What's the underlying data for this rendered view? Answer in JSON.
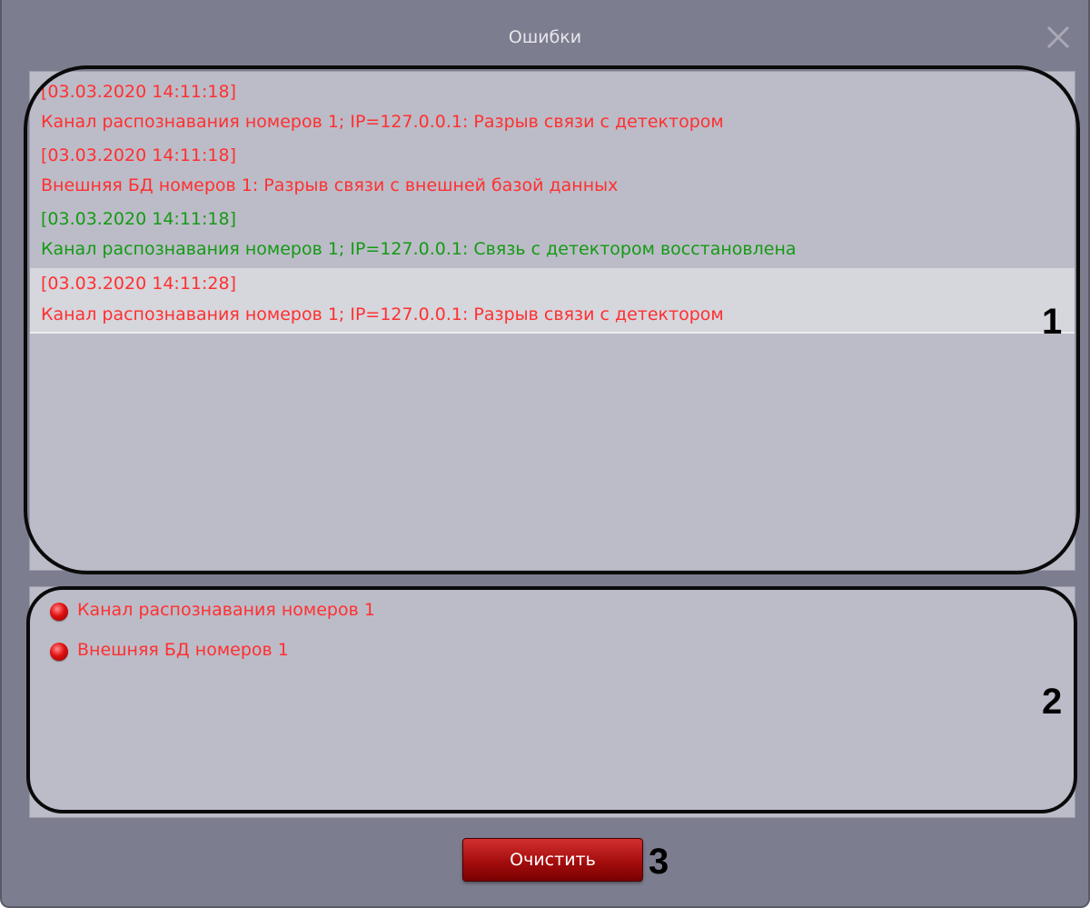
{
  "window": {
    "title": "Ошибки",
    "close_icon": "close-icon"
  },
  "log": {
    "entries": [
      {
        "timestamp": "[03.03.2020 14:11:18]",
        "message": "Канал распознавания номеров 1; IP=127.0.0.1: Разрыв связи с детектором",
        "status": "error",
        "selected": false
      },
      {
        "timestamp": "[03.03.2020 14:11:18]",
        "message": "Внешняя БД номеров 1: Разрыв связи с внешней базой данных",
        "status": "error",
        "selected": false
      },
      {
        "timestamp": "[03.03.2020 14:11:18]",
        "message": "Канал распознавания номеров 1; IP=127.0.0.1: Связь с детектором восстановлена",
        "status": "ok",
        "selected": false
      },
      {
        "timestamp": "[03.03.2020 14:11:28]",
        "message": "Канал распознавания номеров 1; IP=127.0.0.1: Разрыв связи с детектором",
        "status": "error",
        "selected": true
      }
    ]
  },
  "status_list": {
    "items": [
      {
        "label": "Канал распознавания номеров 1",
        "icon": "red-status-dot-icon"
      },
      {
        "label": "Внешняя БД номеров 1",
        "icon": "red-status-dot-icon"
      }
    ]
  },
  "actions": {
    "clear_label": "Очистить"
  },
  "annotations": {
    "marker_1": "1",
    "marker_2": "2",
    "marker_3": "3"
  },
  "colors": {
    "window_bg": "#7d7d90",
    "panel_bg": "#bcbcc8",
    "error_text": "#ff3030",
    "ok_text": "#149a14",
    "button_red": "#a50d0d"
  }
}
